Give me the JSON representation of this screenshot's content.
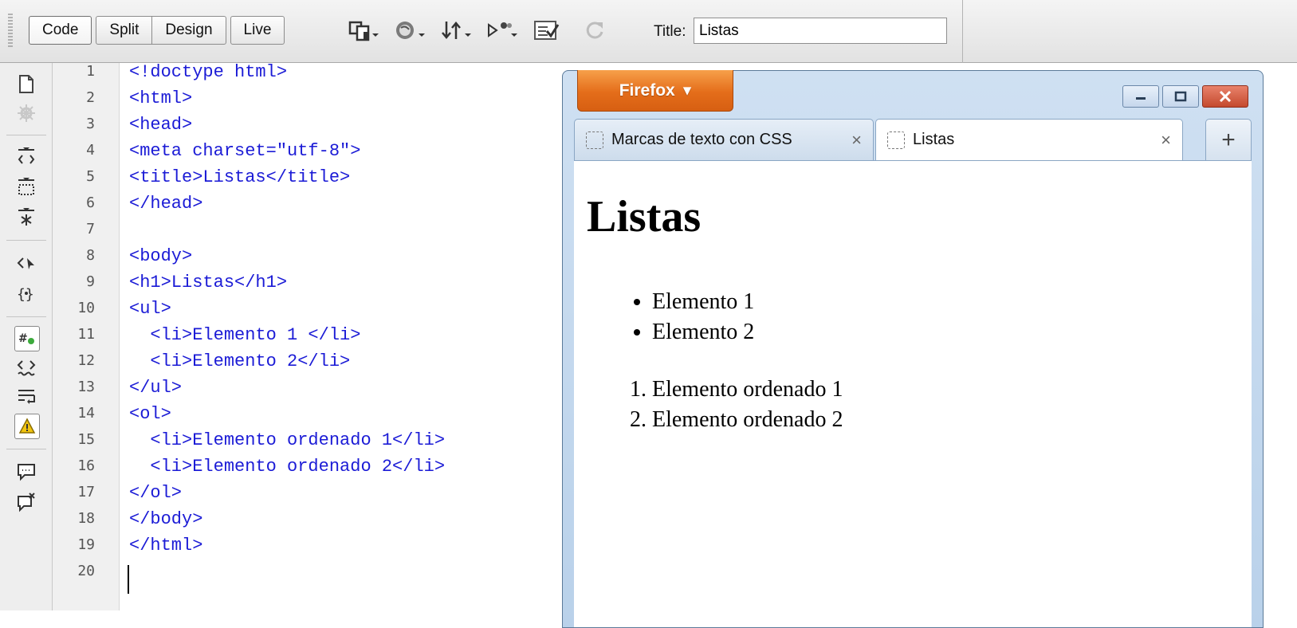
{
  "toolbar": {
    "view_buttons": [
      "Code",
      "Split",
      "Design",
      "Live"
    ],
    "title_label": "Title:",
    "title_value": "Listas",
    "icons": [
      "multiscreen-icon",
      "preview-browser-icon",
      "file-management-icon",
      "live-code-icon",
      "check-page-icon",
      "refresh-icon"
    ]
  },
  "left_toolbar": {
    "icons": [
      "open-documents-icon",
      "show-code-navigator-icon",
      "collapse-full-tag-icon",
      "collapse-selection-icon",
      "expand-all-icon",
      "select-parent-tag-icon",
      "balance-braces-icon",
      "line-numbers-icon",
      "highlight-invalid-code-icon",
      "word-wrap-icon",
      "syntax-error-icon",
      "apply-comment-icon",
      "remove-comment-icon"
    ]
  },
  "editor": {
    "line_numbers": [
      "1",
      "2",
      "3",
      "4",
      "5",
      "6",
      "7",
      "8",
      "9",
      "10",
      "11",
      "12",
      "13",
      "14",
      "15",
      "16",
      "17",
      "18",
      "19",
      "20"
    ],
    "lines": [
      "<!doctype html>",
      "<html>",
      "<head>",
      "<meta charset=\"utf-8\">",
      "<title>Listas</title>",
      "</head>",
      "",
      "<body>",
      "<h1>Listas</h1>",
      "<ul>",
      "  <li>Elemento 1 </li>",
      "  <li>Elemento 2</li>",
      "</ul>",
      "<ol>",
      "  <li>Elemento ordenado 1</li>",
      "  <li>Elemento ordenado 2</li>",
      "</ol>",
      "</body>",
      "</html>",
      ""
    ]
  },
  "browser": {
    "app_button": "Firefox",
    "tabs": [
      {
        "label": "Marcas de texto con CSS",
        "close": "×"
      },
      {
        "label": "Listas",
        "close": "×"
      }
    ],
    "new_tab": "+",
    "page": {
      "heading": "Listas",
      "unordered": [
        "Elemento 1",
        "Elemento 2"
      ],
      "ordered": [
        "Elemento ordenado 1",
        "Elemento ordenado 2"
      ]
    }
  }
}
